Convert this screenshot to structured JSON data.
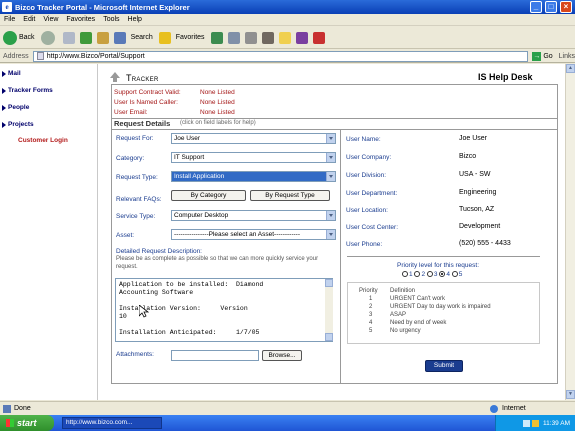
{
  "window": {
    "title": "Bizco Tracker Portal - Microsoft Internet Explorer",
    "controls": [
      "_",
      "□",
      "×"
    ]
  },
  "menu": [
    "File",
    "Edit",
    "View",
    "Favorites",
    "Tools",
    "Help"
  ],
  "toolbar": {
    "back": "Back",
    "search": "Search",
    "favorites": "Favorites"
  },
  "address": {
    "label": "Address",
    "url": "http://www.Bizco/Portal/Support",
    "go": "Go",
    "links": "Links"
  },
  "nav": {
    "items": [
      "Mail",
      "Tracker Forms",
      "People",
      "Projects"
    ],
    "customer_login": "Customer Login"
  },
  "header": {
    "tracker": "Tracker",
    "helpdesk": "IS Help Desk"
  },
  "support_info": [
    {
      "label": "Support Contract Valid:",
      "value": "None Listed"
    },
    {
      "label": "User Is Named Caller:",
      "value": "None Listed"
    },
    {
      "label": "User Email:",
      "value": "None Listed"
    }
  ],
  "request_details": {
    "title": "Request Details",
    "hint": "(click on field labels for help)"
  },
  "form": {
    "request_for": {
      "label": "Request For:",
      "value": "Joe User"
    },
    "category": {
      "label": "Category:",
      "value": "IT Support"
    },
    "request_type": {
      "label": "Request Type:",
      "value": "Install Application"
    },
    "faqs": {
      "label": "Relevant FAQs:",
      "by_category": "By Category",
      "by_request_type": "By Request Type"
    },
    "service_type": {
      "label": "Service Type:",
      "value": "Computer Desktop"
    },
    "asset": {
      "label": "Asset:",
      "value": "----------------Please select an Asset------------"
    },
    "description": {
      "label": "Detailed Request Description:",
      "help": "Please be as complete as possible so that we can more quickly service your request.",
      "lines": [
        "Application to be installed:  Diamond",
        "Accounting Software",
        "",
        "Installation Version:     Version",
        "10",
        "",
        "Installation Anticipated:     1/7/05"
      ]
    },
    "attachments": {
      "label": "Attachments:",
      "browse": "Browse..."
    }
  },
  "user": [
    {
      "label": "User Name:",
      "value": "Joe User"
    },
    {
      "label": "User Company:",
      "value": "Bizco"
    },
    {
      "label": "User Division:",
      "value": "USA - SW"
    },
    {
      "label": "User Department:",
      "value": "Engineering"
    },
    {
      "label": "User Location:",
      "value": "Tucson, AZ"
    },
    {
      "label": "User Cost Center:",
      "value": "Development"
    },
    {
      "label": "User Phone:",
      "value": "(520) 555 - 4433"
    }
  ],
  "priority": {
    "title": "Priority level for this request:",
    "options": [
      "1",
      "2",
      "3",
      "4",
      "5"
    ],
    "selected": "4",
    "col_priority": "Priority",
    "col_definition": "Definition",
    "rows": [
      {
        "p": "1",
        "d": "URGENT Can't work"
      },
      {
        "p": "2",
        "d": "URGENT Day to day work is impaired"
      },
      {
        "p": "3",
        "d": "ASAP"
      },
      {
        "p": "4",
        "d": "Need by end of week"
      },
      {
        "p": "5",
        "d": "No urgency"
      }
    ]
  },
  "submit": "Submit",
  "status": {
    "left": "Done",
    "zone": "Internet"
  },
  "taskbar": {
    "start": "start",
    "item": "http://www.bizco.com...",
    "time": "11:39 AM"
  },
  "colors": {
    "accent": "#1a3c8f",
    "alert": "#a51818",
    "selected": "#316ac5"
  }
}
